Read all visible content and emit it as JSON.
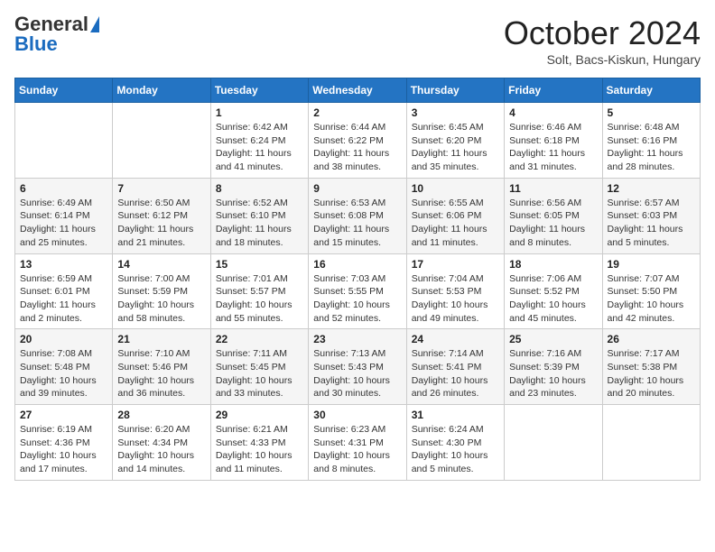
{
  "header": {
    "logo_general": "General",
    "logo_blue": "Blue",
    "title": "October 2024",
    "location": "Solt, Bacs-Kiskun, Hungary"
  },
  "weekdays": [
    "Sunday",
    "Monday",
    "Tuesday",
    "Wednesday",
    "Thursday",
    "Friday",
    "Saturday"
  ],
  "weeks": [
    [
      {
        "day": "",
        "info": ""
      },
      {
        "day": "",
        "info": ""
      },
      {
        "day": "1",
        "info": "Sunrise: 6:42 AM\nSunset: 6:24 PM\nDaylight: 11 hours and 41 minutes."
      },
      {
        "day": "2",
        "info": "Sunrise: 6:44 AM\nSunset: 6:22 PM\nDaylight: 11 hours and 38 minutes."
      },
      {
        "day": "3",
        "info": "Sunrise: 6:45 AM\nSunset: 6:20 PM\nDaylight: 11 hours and 35 minutes."
      },
      {
        "day": "4",
        "info": "Sunrise: 6:46 AM\nSunset: 6:18 PM\nDaylight: 11 hours and 31 minutes."
      },
      {
        "day": "5",
        "info": "Sunrise: 6:48 AM\nSunset: 6:16 PM\nDaylight: 11 hours and 28 minutes."
      }
    ],
    [
      {
        "day": "6",
        "info": "Sunrise: 6:49 AM\nSunset: 6:14 PM\nDaylight: 11 hours and 25 minutes."
      },
      {
        "day": "7",
        "info": "Sunrise: 6:50 AM\nSunset: 6:12 PM\nDaylight: 11 hours and 21 minutes."
      },
      {
        "day": "8",
        "info": "Sunrise: 6:52 AM\nSunset: 6:10 PM\nDaylight: 11 hours and 18 minutes."
      },
      {
        "day": "9",
        "info": "Sunrise: 6:53 AM\nSunset: 6:08 PM\nDaylight: 11 hours and 15 minutes."
      },
      {
        "day": "10",
        "info": "Sunrise: 6:55 AM\nSunset: 6:06 PM\nDaylight: 11 hours and 11 minutes."
      },
      {
        "day": "11",
        "info": "Sunrise: 6:56 AM\nSunset: 6:05 PM\nDaylight: 11 hours and 8 minutes."
      },
      {
        "day": "12",
        "info": "Sunrise: 6:57 AM\nSunset: 6:03 PM\nDaylight: 11 hours and 5 minutes."
      }
    ],
    [
      {
        "day": "13",
        "info": "Sunrise: 6:59 AM\nSunset: 6:01 PM\nDaylight: 11 hours and 2 minutes."
      },
      {
        "day": "14",
        "info": "Sunrise: 7:00 AM\nSunset: 5:59 PM\nDaylight: 10 hours and 58 minutes."
      },
      {
        "day": "15",
        "info": "Sunrise: 7:01 AM\nSunset: 5:57 PM\nDaylight: 10 hours and 55 minutes."
      },
      {
        "day": "16",
        "info": "Sunrise: 7:03 AM\nSunset: 5:55 PM\nDaylight: 10 hours and 52 minutes."
      },
      {
        "day": "17",
        "info": "Sunrise: 7:04 AM\nSunset: 5:53 PM\nDaylight: 10 hours and 49 minutes."
      },
      {
        "day": "18",
        "info": "Sunrise: 7:06 AM\nSunset: 5:52 PM\nDaylight: 10 hours and 45 minutes."
      },
      {
        "day": "19",
        "info": "Sunrise: 7:07 AM\nSunset: 5:50 PM\nDaylight: 10 hours and 42 minutes."
      }
    ],
    [
      {
        "day": "20",
        "info": "Sunrise: 7:08 AM\nSunset: 5:48 PM\nDaylight: 10 hours and 39 minutes."
      },
      {
        "day": "21",
        "info": "Sunrise: 7:10 AM\nSunset: 5:46 PM\nDaylight: 10 hours and 36 minutes."
      },
      {
        "day": "22",
        "info": "Sunrise: 7:11 AM\nSunset: 5:45 PM\nDaylight: 10 hours and 33 minutes."
      },
      {
        "day": "23",
        "info": "Sunrise: 7:13 AM\nSunset: 5:43 PM\nDaylight: 10 hours and 30 minutes."
      },
      {
        "day": "24",
        "info": "Sunrise: 7:14 AM\nSunset: 5:41 PM\nDaylight: 10 hours and 26 minutes."
      },
      {
        "day": "25",
        "info": "Sunrise: 7:16 AM\nSunset: 5:39 PM\nDaylight: 10 hours and 23 minutes."
      },
      {
        "day": "26",
        "info": "Sunrise: 7:17 AM\nSunset: 5:38 PM\nDaylight: 10 hours and 20 minutes."
      }
    ],
    [
      {
        "day": "27",
        "info": "Sunrise: 6:19 AM\nSunset: 4:36 PM\nDaylight: 10 hours and 17 minutes."
      },
      {
        "day": "28",
        "info": "Sunrise: 6:20 AM\nSunset: 4:34 PM\nDaylight: 10 hours and 14 minutes."
      },
      {
        "day": "29",
        "info": "Sunrise: 6:21 AM\nSunset: 4:33 PM\nDaylight: 10 hours and 11 minutes."
      },
      {
        "day": "30",
        "info": "Sunrise: 6:23 AM\nSunset: 4:31 PM\nDaylight: 10 hours and 8 minutes."
      },
      {
        "day": "31",
        "info": "Sunrise: 6:24 AM\nSunset: 4:30 PM\nDaylight: 10 hours and 5 minutes."
      },
      {
        "day": "",
        "info": ""
      },
      {
        "day": "",
        "info": ""
      }
    ]
  ]
}
